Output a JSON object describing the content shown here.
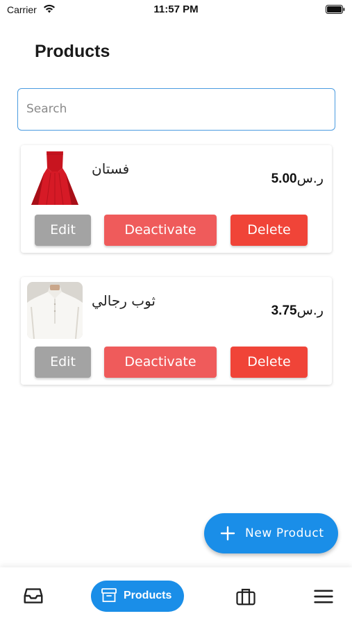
{
  "status_bar": {
    "carrier": "Carrier",
    "time": "11:57 PM"
  },
  "header": {
    "title": "Products"
  },
  "search": {
    "placeholder": "Search",
    "value": ""
  },
  "products": [
    {
      "name": "فستان",
      "currency": "ر.س",
      "price": "5.00",
      "image_icon": "red-dress-image",
      "edit_label": "Edit",
      "deactivate_label": "Deactivate",
      "delete_label": "Delete"
    },
    {
      "name": "ثوب رجالي",
      "currency": "ر.س",
      "price": "3.75",
      "image_icon": "white-thobe-image",
      "edit_label": "Edit",
      "deactivate_label": "Deactivate",
      "delete_label": "Delete"
    }
  ],
  "fab": {
    "label": "New Product",
    "icon": "plus-icon"
  },
  "bottom_nav": {
    "items": [
      {
        "icon": "inbox-icon",
        "label": ""
      },
      {
        "icon": "archive-box-icon",
        "label": "Products",
        "active": true
      },
      {
        "icon": "briefcase-icon",
        "label": ""
      },
      {
        "icon": "hamburger-menu-icon",
        "label": ""
      }
    ]
  },
  "colors": {
    "accent": "#1a8ee8",
    "edit": "#a3a3a3",
    "deactivate": "#ef5b5b",
    "delete": "#f04438",
    "search_border": "#4a9be0"
  }
}
